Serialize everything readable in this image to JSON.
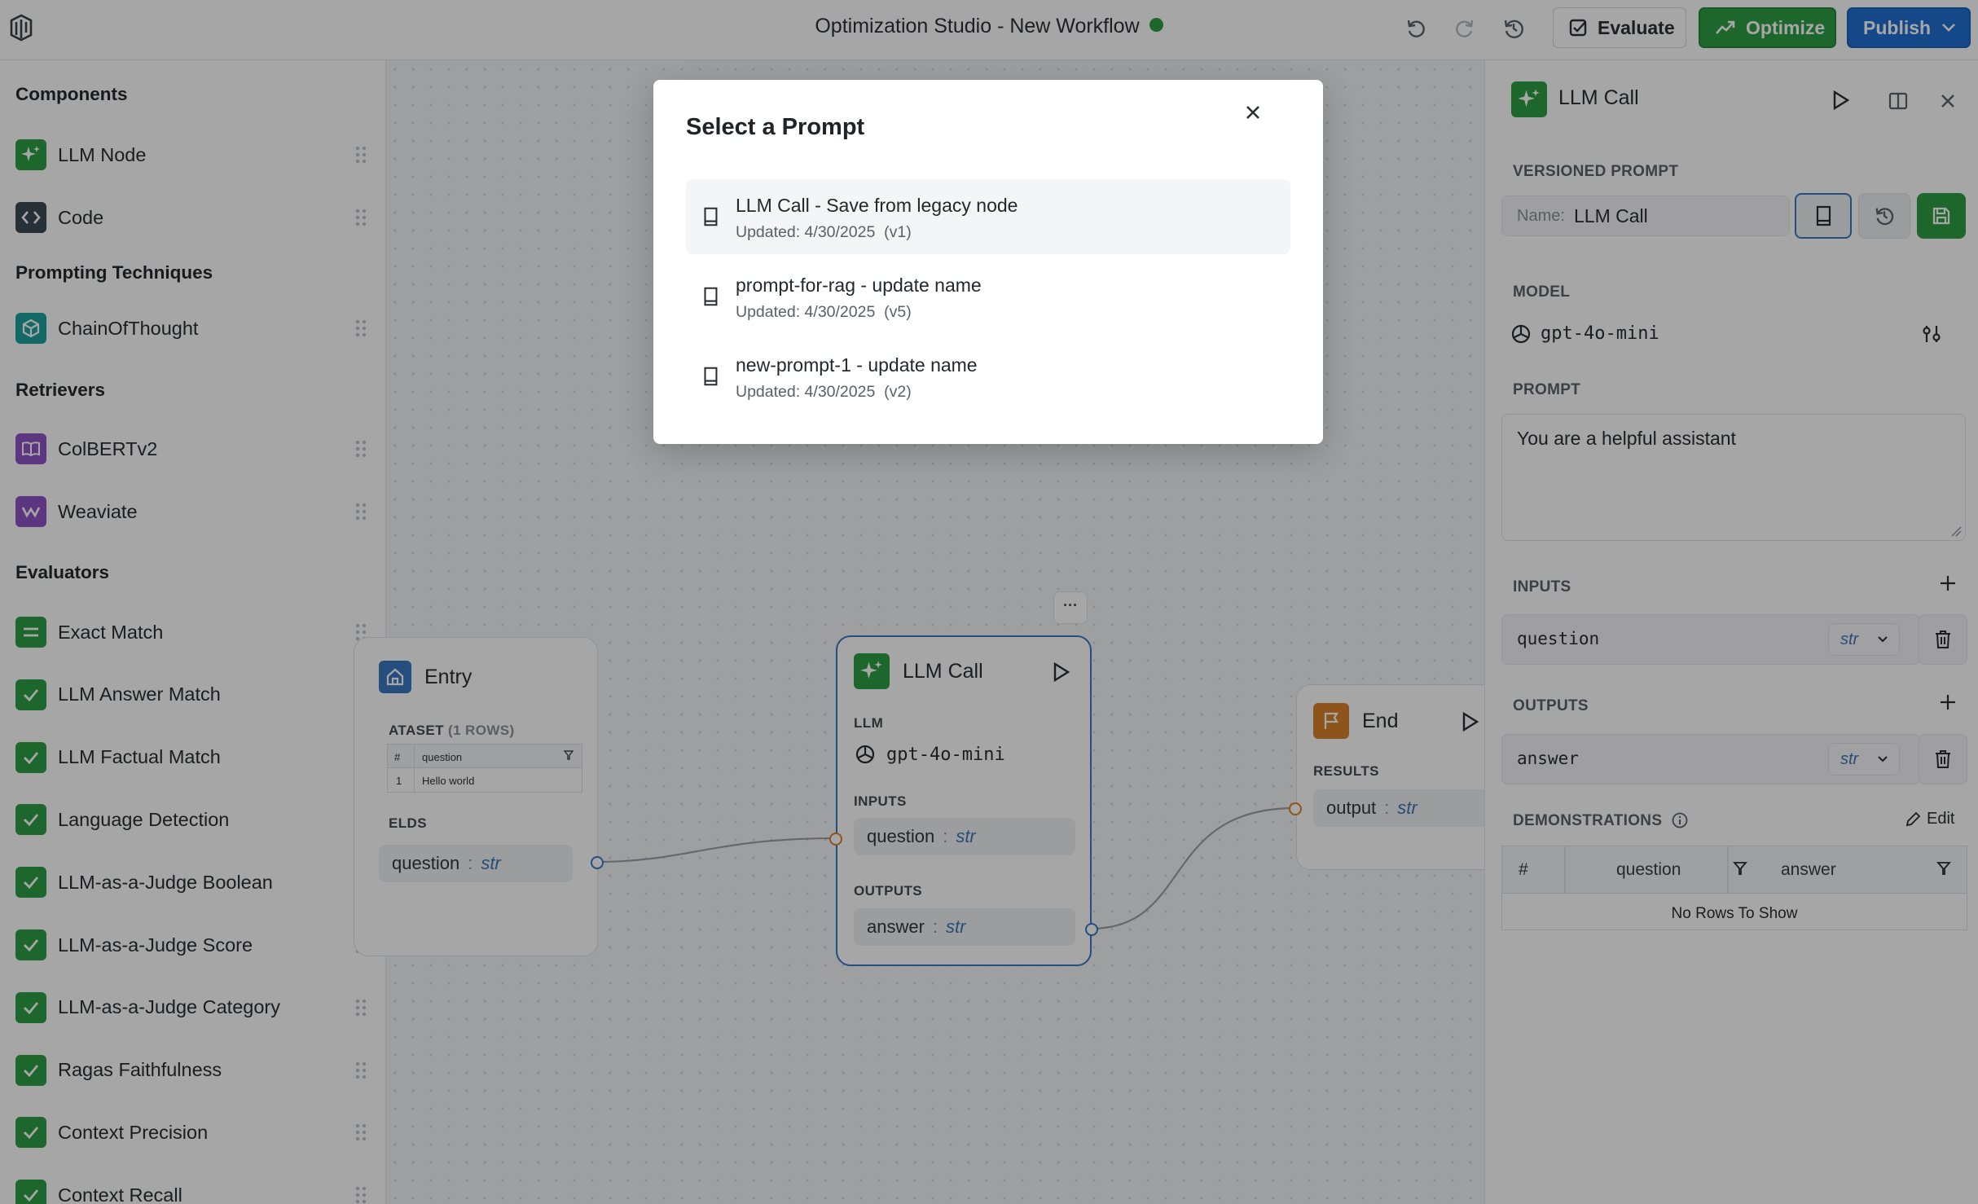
{
  "header": {
    "title": "Optimization Studio - New Workflow",
    "evaluate_label": "Evaluate",
    "optimize_label": "Optimize",
    "publish_label": "Publish"
  },
  "sidebar": {
    "sections": [
      {
        "title": "Components",
        "items": [
          {
            "label": "LLM Node",
            "icon": "sparkles-icon",
            "color": "#2f9e44"
          },
          {
            "label": "Code",
            "icon": "code-icon",
            "color": "#3d4a55"
          }
        ]
      },
      {
        "title": "Prompting Techniques",
        "items": [
          {
            "label": "ChainOfThought",
            "icon": "cube-icon",
            "color": "#1ba39c"
          }
        ]
      },
      {
        "title": "Retrievers",
        "items": [
          {
            "label": "ColBERTv2",
            "icon": "book-open-icon",
            "color": "#8e54c6"
          },
          {
            "label": "Weaviate",
            "icon": "weaviate-icon",
            "color": "#8e54c6"
          }
        ]
      },
      {
        "title": "Evaluators",
        "items": [
          {
            "label": "Exact Match",
            "icon": "equals-icon",
            "color": "#2f9e44"
          },
          {
            "label": "LLM Answer Match",
            "icon": "check-icon",
            "color": "#2f9e44"
          },
          {
            "label": "LLM Factual Match",
            "icon": "check-icon",
            "color": "#2f9e44"
          },
          {
            "label": "Language Detection",
            "icon": "check-icon",
            "color": "#2f9e44"
          },
          {
            "label": "LLM-as-a-Judge Boolean",
            "icon": "check-icon",
            "color": "#2f9e44"
          },
          {
            "label": "LLM-as-a-Judge Score",
            "icon": "check-icon",
            "color": "#2f9e44"
          },
          {
            "label": "LLM-as-a-Judge Category",
            "icon": "check-icon",
            "color": "#2f9e44"
          },
          {
            "label": "Ragas Faithfulness",
            "icon": "check-icon",
            "color": "#2f9e44"
          },
          {
            "label": "Context Precision",
            "icon": "check-icon",
            "color": "#2f9e44"
          },
          {
            "label": "Context Recall",
            "icon": "check-icon",
            "color": "#2f9e44"
          }
        ]
      }
    ]
  },
  "canvas": {
    "entry": {
      "title": "Entry",
      "dataset_label": "ATASET",
      "dataset_rows": "(1 ROWS)",
      "col_hash": "#",
      "col_question": "question",
      "row_num": "1",
      "row_value": "Hello world",
      "fields_label": "ELDS",
      "field_name": "question",
      "field_sep": ":",
      "field_type": "str"
    },
    "llm": {
      "title": "LLM Call",
      "more": "···",
      "llm_label": "LLM",
      "model": "gpt-4o-mini",
      "inputs_label": "INPUTS",
      "input_name": "question",
      "outputs_label": "OUTPUTS",
      "output_name": "answer",
      "sep": ":",
      "type": "str"
    },
    "end": {
      "title": "End",
      "results_label": "RESULTS",
      "output_name": "output",
      "sep": ":",
      "type": "str"
    }
  },
  "panel": {
    "title": "LLM Call",
    "versioned_prompt_label": "VERSIONED PROMPT",
    "name_label": "Name:",
    "name_value": "LLM Call",
    "model_label": "MODEL",
    "model_value": "gpt-4o-mini",
    "prompt_label": "PROMPT",
    "prompt_value": "You are a helpful assistant",
    "inputs_label": "INPUTS",
    "input_name": "question",
    "input_type": "str",
    "outputs_label": "OUTPUTS",
    "output_name": "answer",
    "output_type": "str",
    "demos_label": "DEMONSTRATIONS",
    "edit_label": "Edit",
    "table_cols": [
      "#",
      "question",
      "answer"
    ],
    "empty_text": "No Rows To Show"
  },
  "modal": {
    "title": "Select a Prompt",
    "items": [
      {
        "name": "LLM Call - Save from legacy node",
        "updated": "Updated: 4/30/2025",
        "version": "(v1)"
      },
      {
        "name": "prompt-for-rag - update name",
        "updated": "Updated: 4/30/2025",
        "version": "(v5)"
      },
      {
        "name": "new-prompt-1 - update name",
        "updated": "Updated: 4/30/2025",
        "version": "(v2)"
      }
    ]
  }
}
